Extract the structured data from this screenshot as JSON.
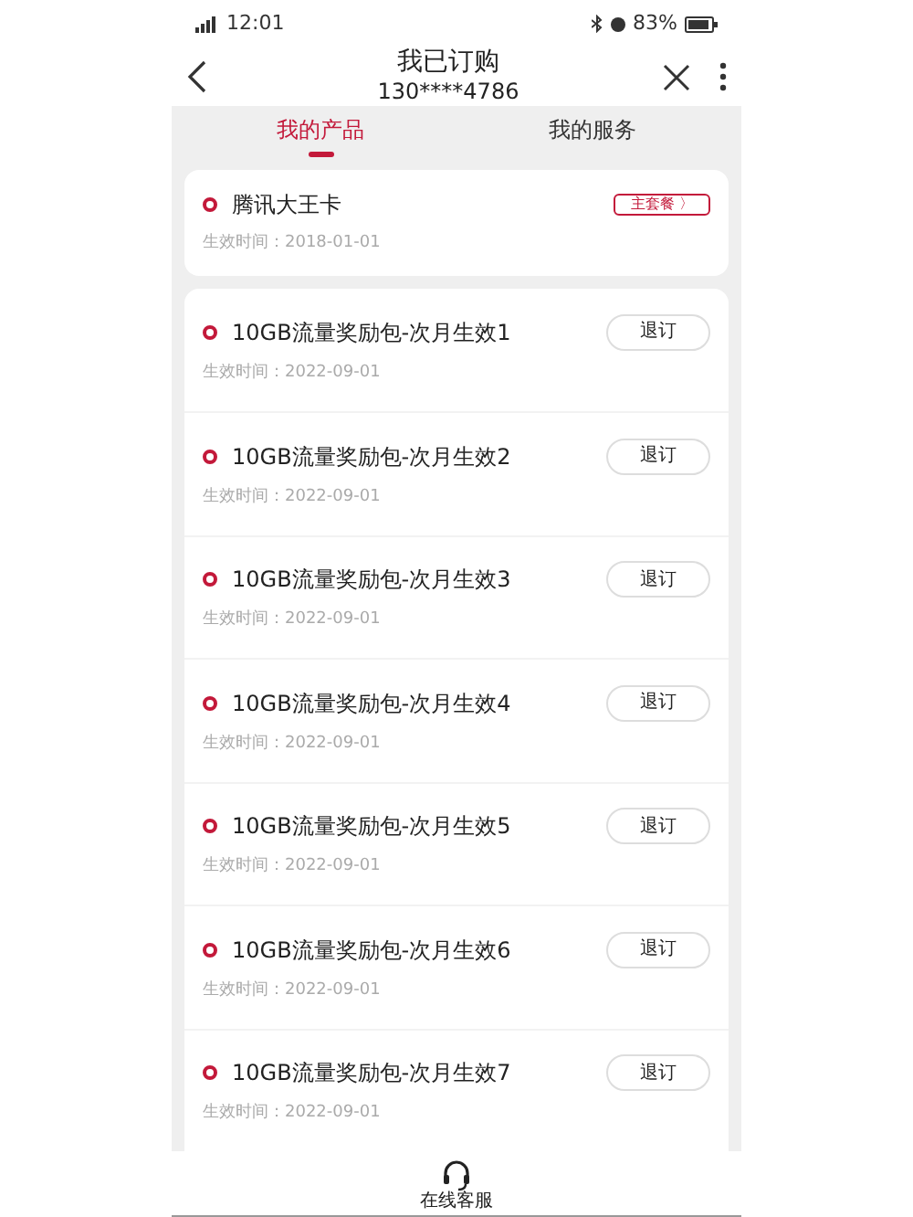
{
  "status_bar": {
    "time": "12:01",
    "battery": "83%"
  },
  "header": {
    "title": "我已订购",
    "subtitle": "130****4786"
  },
  "tabs": [
    {
      "label": "我的产品",
      "selected": true
    },
    {
      "label": "我的服务",
      "selected": false
    }
  ],
  "main_plan": {
    "name": "腾讯大王卡",
    "badge": "主套餐 〉",
    "date": "生效时间：2018-01-01"
  },
  "products": [
    {
      "name": "10GB流量奖励包-次月生效1",
      "date": "生效时间：2022-09-01",
      "button": "退订"
    },
    {
      "name": "10GB流量奖励包-次月生效2",
      "date": "生效时间：2022-09-01",
      "button": "退订"
    },
    {
      "name": "10GB流量奖励包-次月生效3",
      "date": "生效时间：2022-09-01",
      "button": "退订"
    },
    {
      "name": "10GB流量奖励包-次月生效4",
      "date": "生效时间：2022-09-01",
      "button": "退订"
    },
    {
      "name": "10GB流量奖励包-次月生效5",
      "date": "生效时间：2022-09-01",
      "button": "退订"
    },
    {
      "name": "10GB流量奖励包-次月生效6",
      "date": "生效时间：2022-09-01",
      "button": "退订"
    },
    {
      "name": "10GB流量奖励包-次月生效7",
      "date": "生效时间：2022-09-01",
      "button": "退订"
    }
  ],
  "footer": {
    "label": "在线客服"
  }
}
